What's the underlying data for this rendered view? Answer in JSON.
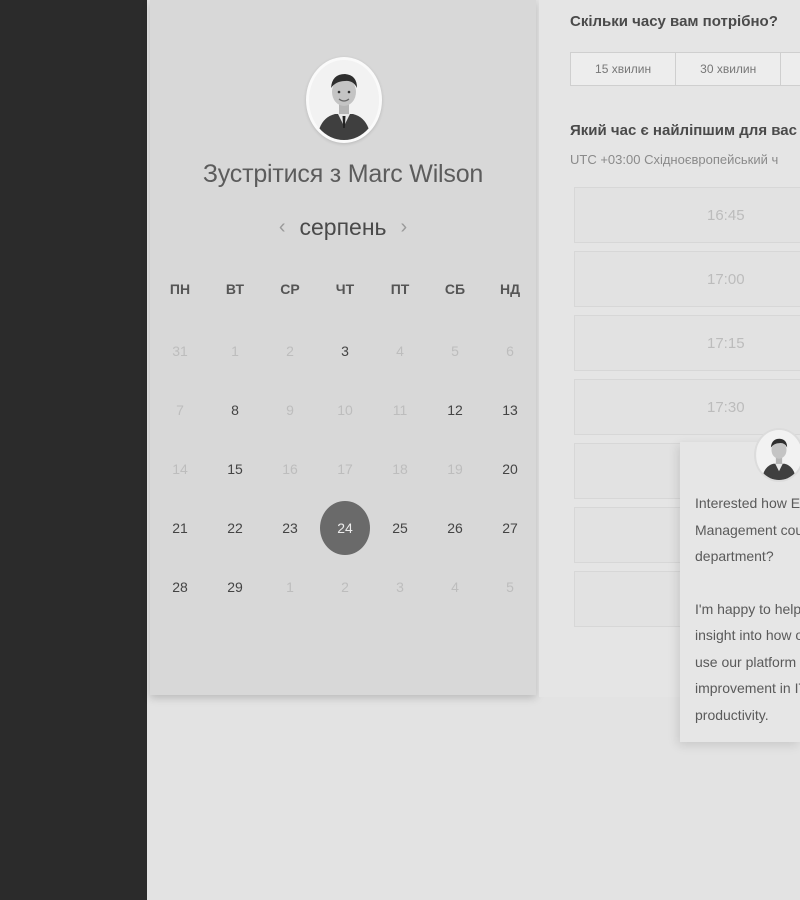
{
  "scheduler": {
    "title": "Зустрітися з Marc Wilson",
    "month": "серпень",
    "prev_icon": "‹",
    "next_icon": "›",
    "weekdays": [
      "ПН",
      "ВТ",
      "СР",
      "ЧТ",
      "ПТ",
      "СБ",
      "НД"
    ],
    "weeks": [
      [
        "31",
        "1",
        "2",
        "3",
        "4",
        "5",
        "6"
      ],
      [
        "7",
        "8",
        "9",
        "10",
        "11",
        "12",
        "13"
      ],
      [
        "14",
        "15",
        "16",
        "17",
        "18",
        "19",
        "20"
      ],
      [
        "21",
        "22",
        "23",
        "24",
        "25",
        "26",
        "27"
      ],
      [
        "28",
        "29",
        "1",
        "2",
        "3",
        "4",
        "5"
      ]
    ],
    "available": [
      [
        false,
        false,
        false,
        true,
        false,
        false,
        false
      ],
      [
        false,
        true,
        false,
        false,
        false,
        true,
        true
      ],
      [
        false,
        true,
        false,
        false,
        false,
        false,
        true
      ],
      [
        true,
        true,
        true,
        true,
        true,
        true,
        true
      ],
      [
        true,
        true,
        false,
        false,
        false,
        false,
        false
      ]
    ],
    "selected": "24"
  },
  "duration": {
    "question": "Скільки часу вам потрібно?",
    "options": [
      "15 хвилин",
      "30 хвилин",
      ""
    ]
  },
  "time": {
    "question": "Який час є найліпшим для вас",
    "timezone": "UTC +03:00 Східноєвропейський ч",
    "slots": [
      "16:45",
      "17:00",
      "17:15",
      "17:30",
      "",
      "",
      ""
    ]
  },
  "chat": {
    "lines_1": [
      "Interested how Ex",
      "Management cou",
      "department?"
    ],
    "lines_2": [
      "I'm happy to help",
      "insight into how o",
      "use our platform t",
      "improvement in IT",
      "productivity."
    ]
  },
  "colors": {
    "selected_day": "#6a6a6a",
    "dark_sidebar": "#2b2b2b"
  }
}
